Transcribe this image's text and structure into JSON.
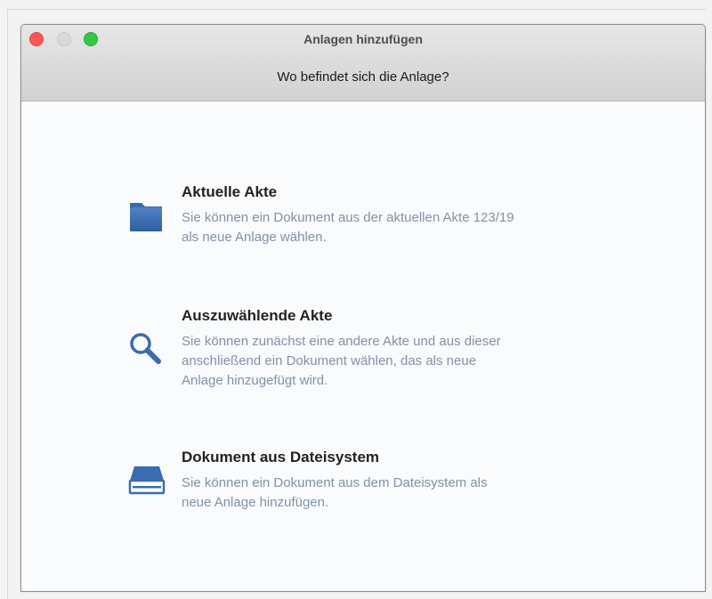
{
  "window": {
    "title": "Anlagen hinzufügen",
    "prompt": "Wo befindet sich die Anlage?"
  },
  "options": [
    {
      "icon": "folder-icon",
      "title": "Aktuelle Akte",
      "description_lines": [
        "Sie können ein Dokument aus der aktuellen Akte 123/19",
        "als neue Anlage wählen."
      ]
    },
    {
      "icon": "magnifier-icon",
      "title": "Auszuwählende Akte",
      "description_lines": [
        "Sie können zunächst eine andere Akte und aus dieser",
        "anschließend ein Dokument wählen, das als neue",
        "Anlage hinzugefügt wird."
      ]
    },
    {
      "icon": "file-tray-icon",
      "title": "Dokument aus Dateisystem",
      "description_lines": [
        "Sie können ein Dokument aus dem Dateisystem als",
        "neue Anlage hinzufügen."
      ]
    }
  ],
  "colors": {
    "accent": "#3b6bb0",
    "description_text": "#8291a7",
    "close_button": "#fc5753",
    "zoom_button": "#33c748"
  }
}
